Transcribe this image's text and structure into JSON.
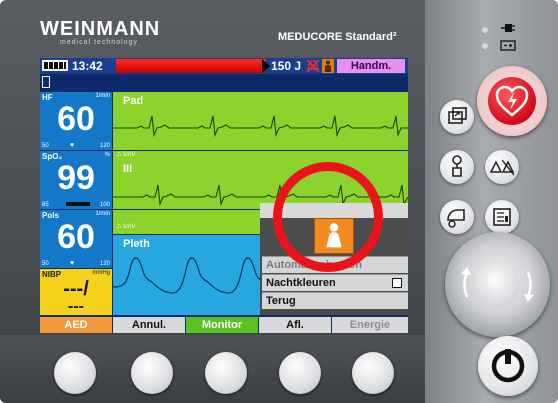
{
  "brand": {
    "name": "WEINMANN",
    "sub": "medical technology",
    "model": "MEDUCORE Standard²"
  },
  "status": {
    "time": "13:42",
    "energy": "150 J",
    "mode": "Handm."
  },
  "vitals": {
    "hf": {
      "label": "HF",
      "unit": "1/min",
      "value": "60",
      "low": "50",
      "high": "120"
    },
    "spo2": {
      "label": "SpO₂",
      "unit": "%",
      "value": "99",
      "low": "85",
      "high": "100"
    },
    "pols": {
      "label": "Pols",
      "unit": "1/min",
      "value": "60",
      "low": "50",
      "high": "120"
    },
    "nibp": {
      "label": "NIBP",
      "unit": "mmHg",
      "value": "---/",
      "value2": "---"
    }
  },
  "waves": {
    "pad": {
      "label": "Pad",
      "mark": "⎍ 1mV"
    },
    "iii": {
      "label": "III",
      "mark": "⎍ 1mV"
    },
    "iii2": {
      "mark": "⎍ 1mV"
    },
    "pleth": {
      "label": "Pleth"
    }
  },
  "menu": {
    "items": [
      {
        "label": "Automatisch gr.en"
      },
      {
        "label": "Nachtkleuren"
      },
      {
        "label": "Terug"
      }
    ]
  },
  "softkeys": [
    {
      "label": "AED"
    },
    {
      "label": "Annul."
    },
    {
      "label": "Monitor"
    },
    {
      "label": "Afl."
    },
    {
      "label": "Energie"
    }
  ],
  "colors": {
    "screen_bg": "#0f2a6b",
    "wave_green": "#8cd32d",
    "pleth_blue": "#27a7df",
    "nibp_yellow": "#f4d21c",
    "alarm_red": "#e8161c",
    "mode_badge": "#e890f2",
    "aed_orange": "#f29a3a",
    "monitor_green": "#58c21f"
  },
  "icons": {
    "shock": "heart-lightning-icon",
    "window": "window-switch-icon",
    "connector": "electrode-connector-icon",
    "alarm": "alarm-bells-icon",
    "bp": "blood-pressure-cuff-icon",
    "report": "report-icon",
    "power": "power-icon",
    "plug": "mains-plug-icon",
    "battery": "battery-icon",
    "person": "person-icon",
    "alarm_off": "alarm-off-icon"
  }
}
